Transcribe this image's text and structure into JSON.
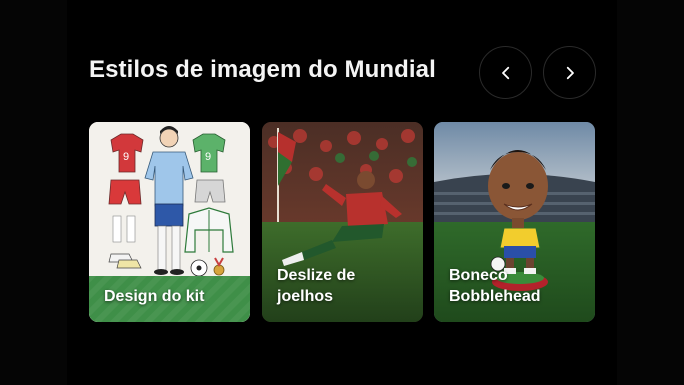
{
  "section": {
    "title": "Estilos de imagem do Mundial"
  },
  "nav": {
    "prev_icon": "chevron-left-icon",
    "next_icon": "chevron-right-icon"
  },
  "cards": [
    {
      "label": "Design do kit",
      "jersey_number": "9"
    },
    {
      "label": "Deslize de\njoelhos"
    },
    {
      "label": "Boneco\nBobblehead"
    }
  ],
  "colors": {
    "background": "#000000",
    "title": "#f4f4f4",
    "card_label": "#ffffff",
    "button_border": "#2a2a2a"
  }
}
